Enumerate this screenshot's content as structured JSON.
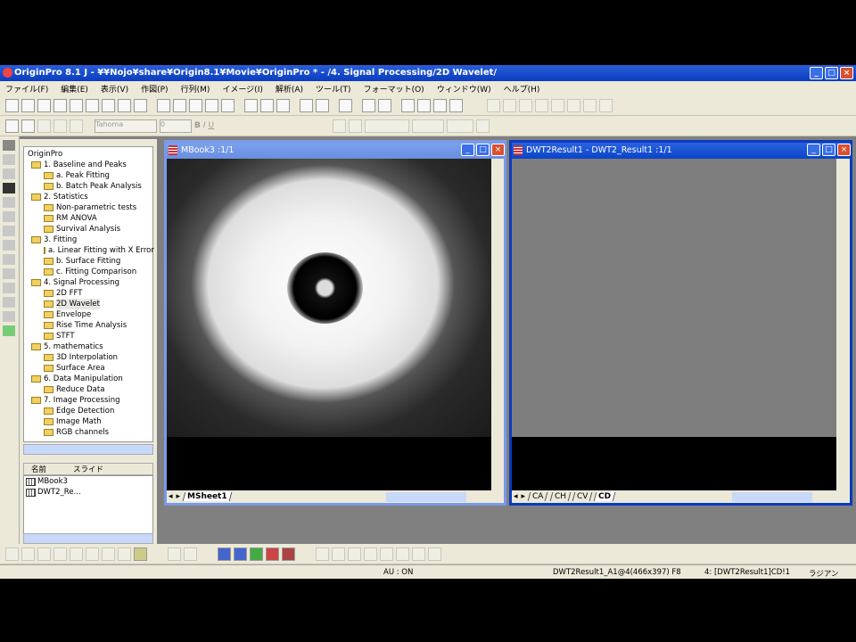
{
  "app": {
    "title": "OriginPro 8.1 J - ¥¥Nojo¥share¥Origin8.1¥Movie¥OriginPro * - /4. Signal Processing/2D Wavelet/"
  },
  "menu": [
    "ファイル(F)",
    "編集(E)",
    "表示(V)",
    "作図(P)",
    "行列(M)",
    "イメージ(I)",
    "解析(A)",
    "ツール(T)",
    "フォーマット(O)",
    "ウィンドウ(W)",
    "ヘルプ(H)"
  ],
  "format_toolbar": {
    "font": "Tahoma",
    "size": "0",
    "style_labels": [
      "B",
      "I",
      "U"
    ]
  },
  "explorer": {
    "root": "OriginPro",
    "tree": [
      {
        "label": "1. Baseline and Peaks",
        "level": 1
      },
      {
        "label": "a. Peak Fitting",
        "level": 2
      },
      {
        "label": "b. Batch Peak Analysis",
        "level": 2
      },
      {
        "label": "2. Statistics",
        "level": 1
      },
      {
        "label": "Non-parametric tests",
        "level": 2
      },
      {
        "label": "RM ANOVA",
        "level": 2
      },
      {
        "label": "Survival Analysis",
        "level": 2
      },
      {
        "label": "3. Fitting",
        "level": 1
      },
      {
        "label": "a. Linear Fitting with X Error",
        "level": 2
      },
      {
        "label": "b. Surface Fitting",
        "level": 2
      },
      {
        "label": "c. Fitting Comparison",
        "level": 2
      },
      {
        "label": "4. Signal Processing",
        "level": 1
      },
      {
        "label": "2D FFT",
        "level": 2
      },
      {
        "label": "2D Wavelet",
        "level": 2,
        "selected": true
      },
      {
        "label": "Envelope",
        "level": 2
      },
      {
        "label": "Rise Time Analysis",
        "level": 2
      },
      {
        "label": "STFT",
        "level": 2
      },
      {
        "label": "5. mathematics",
        "level": 1
      },
      {
        "label": "3D Interpolation",
        "level": 2
      },
      {
        "label": "Surface Area",
        "level": 2
      },
      {
        "label": "6. Data Manipulation",
        "level": 1
      },
      {
        "label": "Reduce Data",
        "level": 2
      },
      {
        "label": "7. Image Processing",
        "level": 1
      },
      {
        "label": "Edge Detection",
        "level": 2
      },
      {
        "label": "Image Math",
        "level": 2
      },
      {
        "label": "RGB channels",
        "level": 2
      }
    ],
    "list_headers": {
      "name": "名前",
      "slide": "スライド"
    },
    "list_items": [
      "MBook3",
      "DWT2_Re..."
    ]
  },
  "windows": {
    "mbook": {
      "title": "MBook3 :1/1",
      "tabs": [
        "MSheet1"
      ],
      "active_tab": "MSheet1"
    },
    "dwt": {
      "title": "DWT2Result1 - DWT2_Result1 :1/1",
      "tabs": [
        "CA",
        "CH",
        "CV",
        "CD"
      ],
      "active_tab": "CD"
    }
  },
  "status": {
    "au": "AU : ON",
    "cell": "DWT2Result1_A1@4(466x397) F8",
    "sheet": "4: [DWT2Result1]CD!1",
    "unit": "ラジアン"
  }
}
